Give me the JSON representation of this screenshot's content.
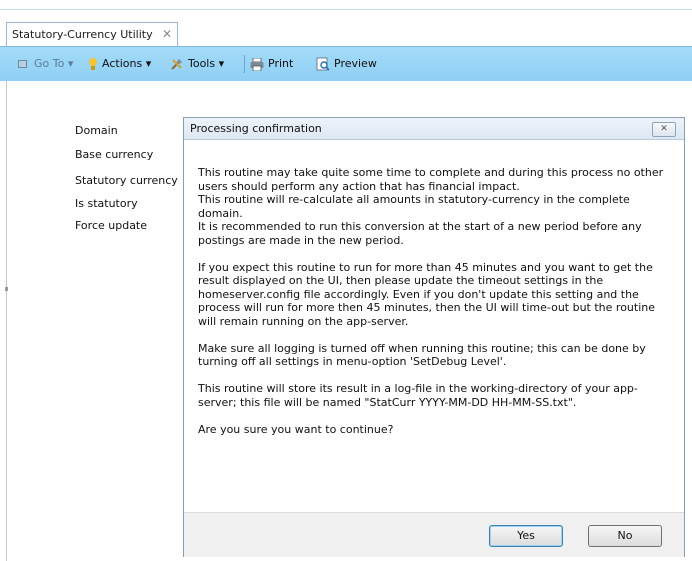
{
  "tab": {
    "title": "Statutory-Currency Utility",
    "close_glyph": "✕"
  },
  "toolbar": {
    "goto_label": "Go To",
    "actions_label": "Actions",
    "tools_label": "Tools",
    "print_label": "Print",
    "preview_label": "Preview",
    "dropdown_glyph": "▾"
  },
  "form": {
    "labels": [
      "Domain",
      "Base currency",
      "Statutory currency",
      "Is statutory",
      "Force update"
    ]
  },
  "dialog": {
    "title": "Processing confirmation",
    "close_glyph": "✕",
    "paragraphs": [
      "This routine may take quite some time to complete and during this process no other users should perform any action that has financial impact.\nThis routine will re-calculate all amounts in statutory-currency in the complete domain.\nIt is recommended to run this conversion at the start of a new period before any postings are made in the new period.",
      "If you expect this routine to run for more than 45 minutes and you want to get the result displayed on the UI, then please update the timeout settings in the homeserver.config file accordingly. Even if you don't update this setting and the process will run for more then 45 minutes, then the UI will time-out but the routine will remain running on the app-server.",
      "Make sure all logging is turned off when running this routine; this can be done by turning off all settings in menu-option 'SetDebug Level'.",
      "This routine will store its result in a log-file in the working-directory of your app-server; this file will be named \"StatCurr YYYY-MM-DD HH-MM-SS.txt\".",
      "Are you sure you want to continue?"
    ],
    "yes_label": "Yes",
    "no_label": "No"
  }
}
